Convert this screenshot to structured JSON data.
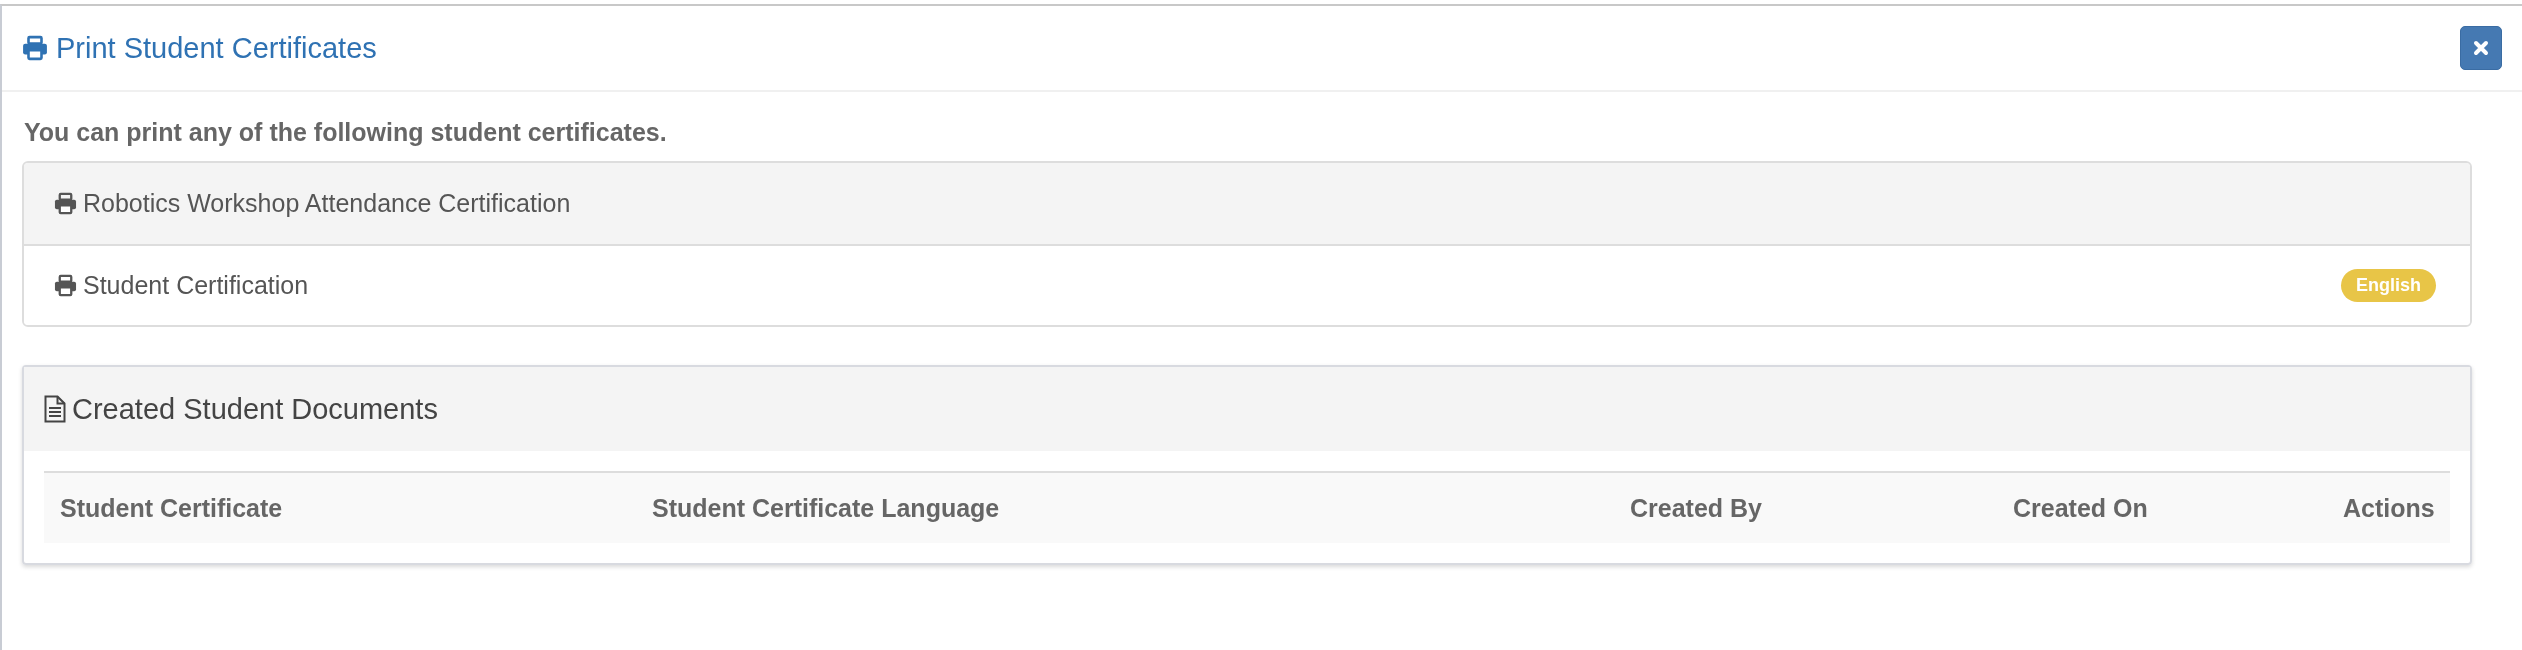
{
  "modal": {
    "title": "Print Student Certificates"
  },
  "intro": "You can print any of the following student certificates.",
  "certificates": [
    {
      "kind": "shaded",
      "label": "Robotics Workshop Attendance Certification"
    },
    {
      "kind": "plain",
      "label": "Student Certification",
      "badge": "English"
    }
  ],
  "documents_panel": {
    "title": "Created Student Documents",
    "table": {
      "columns": [
        "Student Certificate",
        "Student Certificate Language",
        "Created By",
        "Created On",
        "Actions"
      ]
    }
  }
}
